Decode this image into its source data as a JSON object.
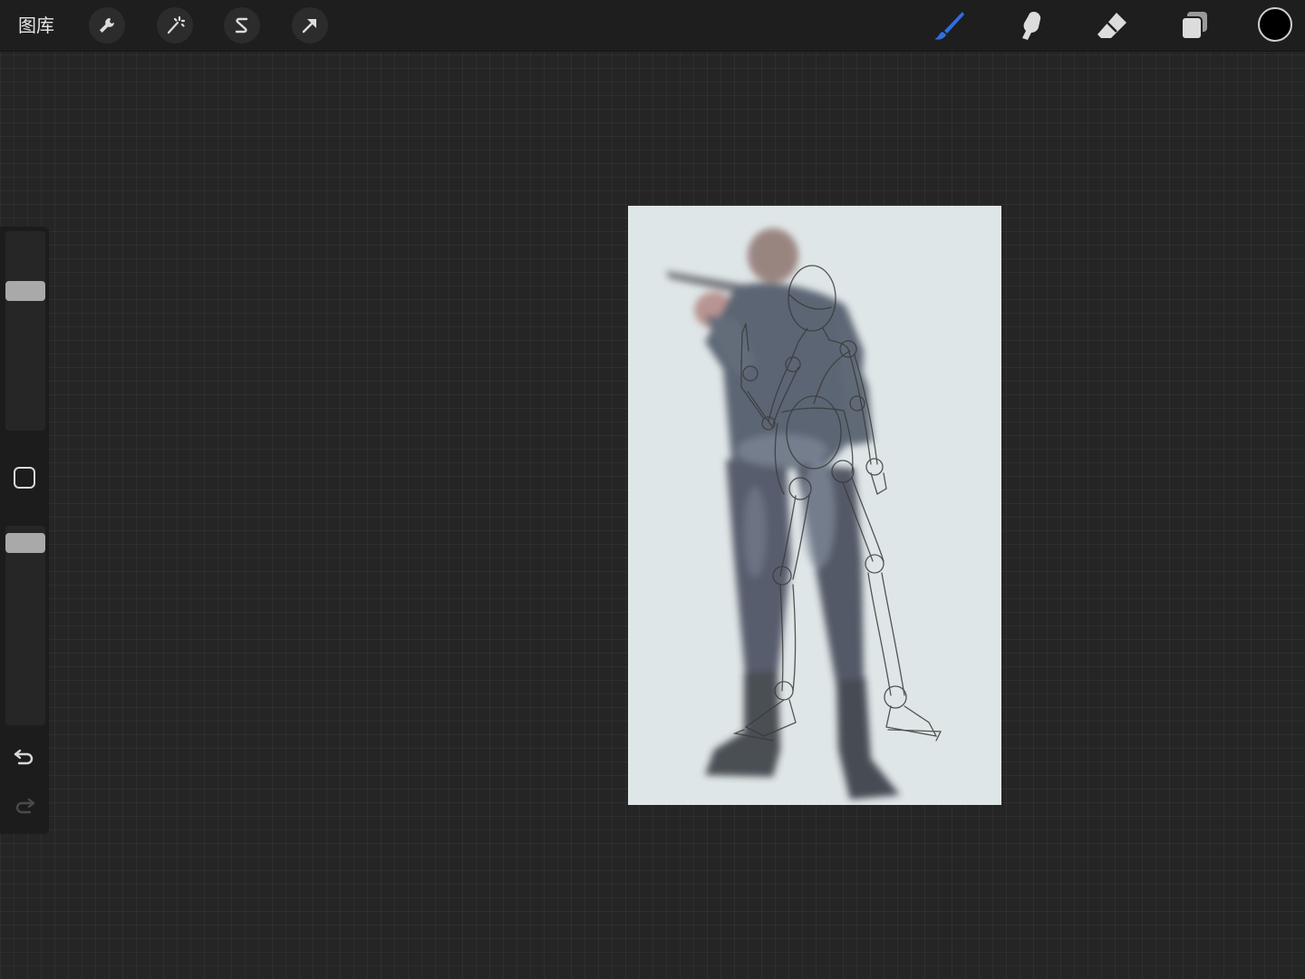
{
  "toolbar": {
    "gallery_label": "图库",
    "left_tools": [
      {
        "name": "actions",
        "icon": "wrench-icon"
      },
      {
        "name": "adjustments",
        "icon": "magic-wand-icon"
      },
      {
        "name": "selection",
        "icon": "selection-s-icon"
      },
      {
        "name": "transform",
        "icon": "arrow-cursor-icon"
      }
    ],
    "right_tools": [
      {
        "name": "brush",
        "icon": "brush-icon",
        "active": true
      },
      {
        "name": "smudge",
        "icon": "smudge-finger-icon",
        "active": false
      },
      {
        "name": "eraser",
        "icon": "eraser-icon",
        "active": false
      },
      {
        "name": "layers",
        "icon": "layers-icon",
        "active": false
      }
    ],
    "current_color": "#000000",
    "active_tool_color": "#2f6fe0"
  },
  "sidebar": {
    "brush_size_level": 0.72,
    "opacity_level": 0.96,
    "modify_button_icon": "square-icon",
    "undo_icon": "undo-icon",
    "redo_icon": "redo-icon"
  },
  "canvas": {
    "background_color": "#dfe6e7",
    "content": "reference-photo-soldier-with-rifle-and-pencil-sketch-overlay"
  }
}
